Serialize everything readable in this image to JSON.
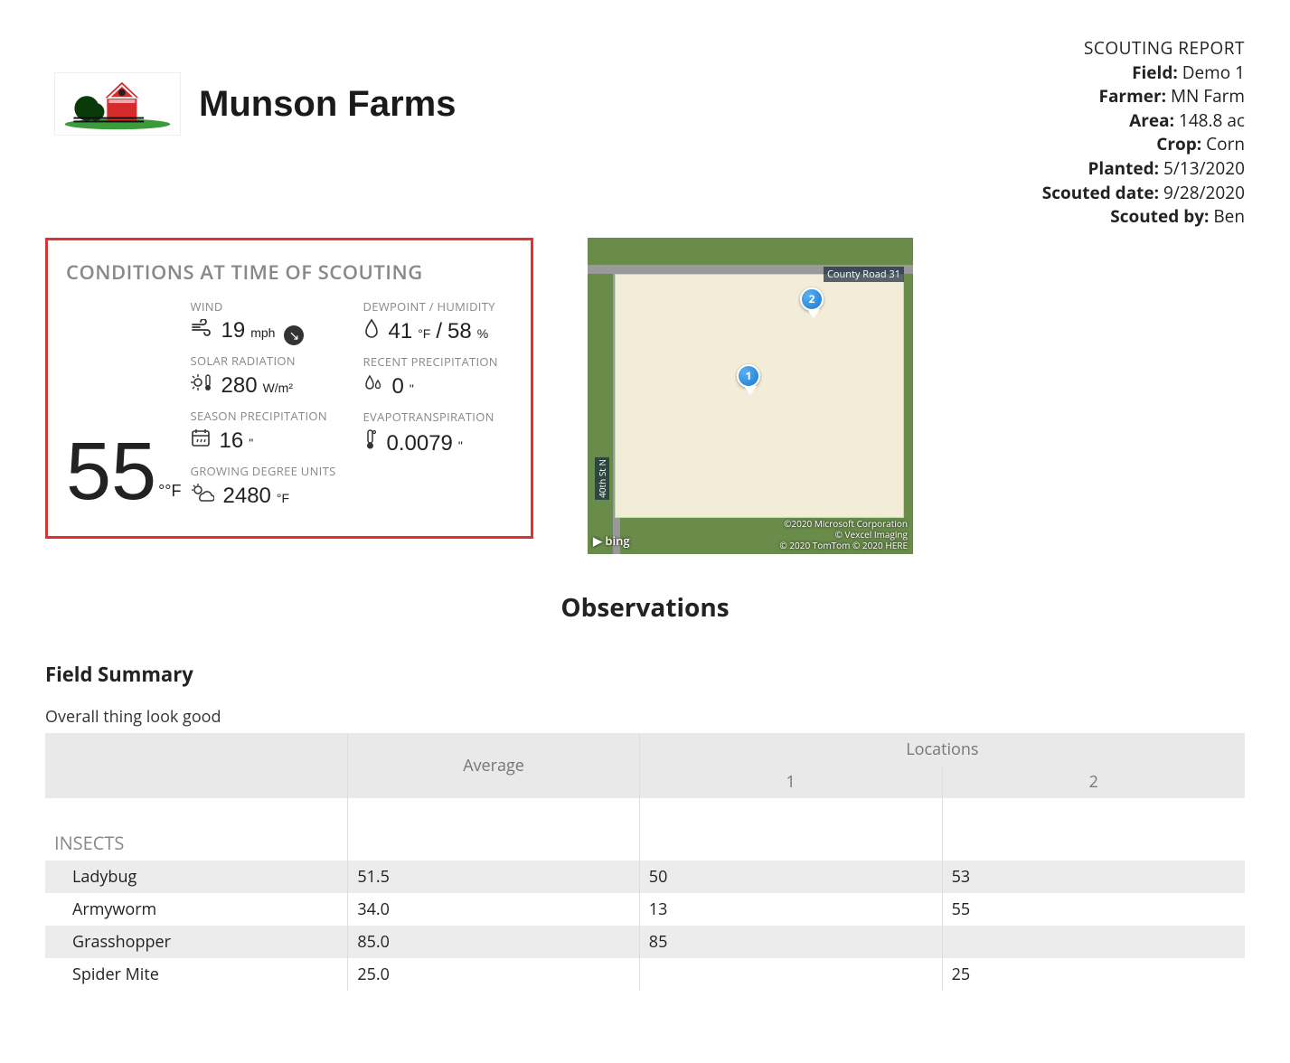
{
  "farm_name": "Munson Farms",
  "report": {
    "title": "SCOUTING REPORT",
    "field_label": "Field:",
    "field": "Demo 1",
    "farmer_label": "Farmer:",
    "farmer": "MN Farm",
    "area_label": "Area:",
    "area": "148.8 ac",
    "crop_label": "Crop:",
    "crop": "Corn",
    "planted_label": "Planted:",
    "planted": "5/13/2020",
    "scouted_date_label": "Scouted date:",
    "scouted_date": "9/28/2020",
    "scouted_by_label": "Scouted by:",
    "scouted_by": "Ben"
  },
  "conditions": {
    "title": "CONDITIONS AT TIME OF SCOUTING",
    "temp": "55",
    "temp_unit": "°°F",
    "wind_label": "WIND",
    "wind_val": "19",
    "wind_unit": "mph",
    "solar_label": "SOLAR RADIATION",
    "solar_val": "280",
    "solar_unit": "W/m²",
    "season_precip_label": "SEASON PRECIPITATION",
    "season_precip_val": "16",
    "season_precip_unit": "\"",
    "gdu_label": "GROWING DEGREE UNITS",
    "gdu_val": "2480",
    "gdu_unit": "°F",
    "dewpoint_label": "DEWPOINT / HUMIDITY",
    "dewpoint_val": "41",
    "dewpoint_unit": "°F",
    "humidity_val": "58",
    "humidity_unit": "%",
    "recent_precip_label": "RECENT PRECIPITATION",
    "recent_precip_val": "0",
    "recent_precip_unit": "\"",
    "evapo_label": "EVAPOTRANSPIRATION",
    "evapo_val": "0.0079",
    "evapo_unit": "\""
  },
  "map": {
    "road1": "County Road 31",
    "road2": "40th St N",
    "pin1": "1",
    "pin2": "2",
    "bing": "▶ bing",
    "credit1": "©2020 Microsoft Corporation",
    "credit2": "© Vexcel Imaging",
    "credit3": "© 2020 TomTom © 2020 HERE"
  },
  "observations_heading": "Observations",
  "field_summary_heading": "Field Summary",
  "field_summary_note": "Overall thing look good",
  "table": {
    "avg_header": "Average",
    "loc_header": "Locations",
    "loc1": "1",
    "loc2": "2",
    "category": "INSECTS",
    "rows": [
      {
        "name": "Ladybug",
        "avg": "51.5",
        "l1": "50",
        "l2": "53"
      },
      {
        "name": "Armyworm",
        "avg": "34.0",
        "l1": "13",
        "l2": "55"
      },
      {
        "name": "Grasshopper",
        "avg": "85.0",
        "l1": "85",
        "l2": ""
      },
      {
        "name": "Spider Mite",
        "avg": "25.0",
        "l1": "",
        "l2": "25"
      }
    ]
  }
}
